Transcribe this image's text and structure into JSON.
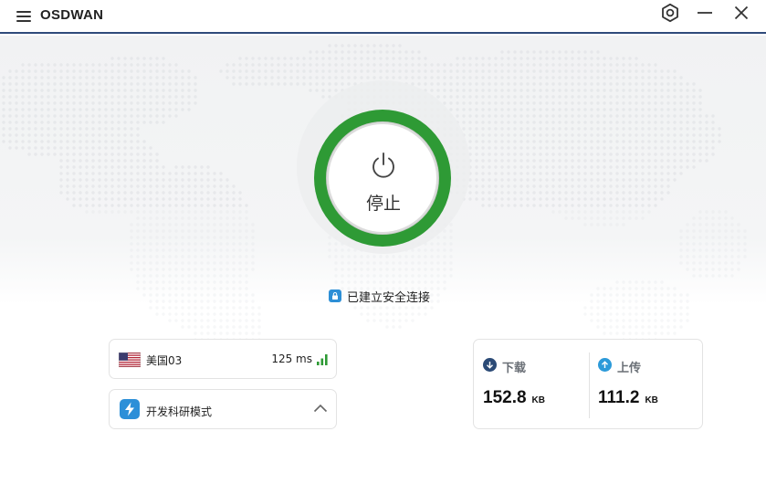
{
  "app": {
    "title": "OSDWAN"
  },
  "power": {
    "label": "停止",
    "ring_color": "#2e9a35"
  },
  "status": {
    "text": "已建立安全连接"
  },
  "server": {
    "name": "美国03",
    "latency": "125 ms",
    "flag": "us-flag-icon"
  },
  "mode": {
    "label": "开发科研模式"
  },
  "stats": {
    "download": {
      "title": "下载",
      "value": "152.8",
      "unit": "KB",
      "icon_color": "#2b4a76"
    },
    "upload": {
      "title": "上传",
      "value": "111.2",
      "unit": "KB",
      "icon_color": "#2c9ad9"
    }
  },
  "colors": {
    "accent": "#2c8fd8",
    "titlebar_border": "#2f4a7a"
  }
}
